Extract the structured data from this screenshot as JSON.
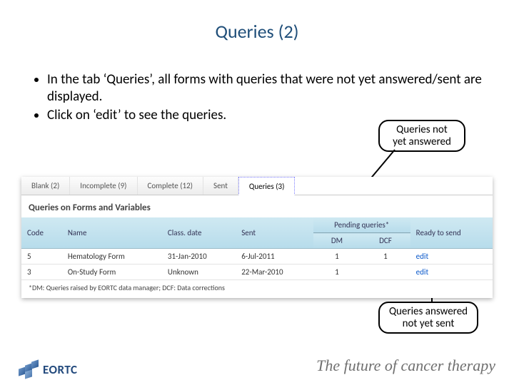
{
  "title": "Queries (2)",
  "bullets": {
    "b1": "In the tab ‘Queries’, all forms with queries that were not yet answered/sent are displayed.",
    "b2": "Click on ‘edit’ to see the queries."
  },
  "callouts": {
    "c1_line1": "Queries not",
    "c1_line2": "yet answered",
    "c2_line1": "Queries answered",
    "c2_line2": "not yet sent"
  },
  "tabs": {
    "t0": "Blank (2)",
    "t1": "Incomplete (9)",
    "t2": "Complete (12)",
    "t3": "Sent",
    "t4": "Queries (3)"
  },
  "section_title": "Queries on Forms and Variables",
  "headers": {
    "code": "Code",
    "name": "Name",
    "classdate": "Class. date",
    "sent": "Sent",
    "pending": "Pending queries*",
    "dm": "DM",
    "dcf": "DCF",
    "ready": "Ready to send"
  },
  "rows": {
    "r0": {
      "code": "5",
      "name": "Hematology Form",
      "classdate": "31-Jan-2010",
      "sent": "6-Jul-2011",
      "dm": "1",
      "dcf": "1",
      "ready": "edit"
    },
    "r1": {
      "code": "3",
      "name": "On-Study Form",
      "classdate": "Unknown",
      "sent": "22-Mar-2010",
      "dm": "1",
      "dcf": "",
      "ready": "edit"
    }
  },
  "footnote": "*DM: Queries raised by EORTC data manager; DCF: Data corrections",
  "brand": "EORTC",
  "tagline": "The future of cancer therapy"
}
